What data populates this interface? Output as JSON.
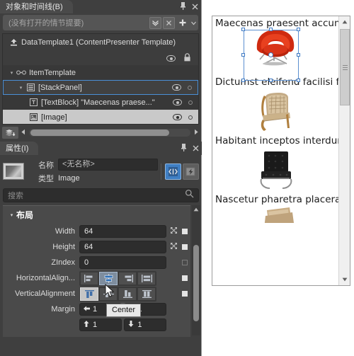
{
  "objects_panel": {
    "tab_title": "对象和时间线(B)",
    "pin_icon": "pin-icon",
    "close_icon": "close-icon",
    "storyboard": {
      "text": "(没有打开的情节提要)",
      "buttons": [
        {
          "name": "storyboard-picker-button",
          "glyph": "»"
        },
        {
          "name": "storyboard-close-button",
          "glyph": "✕"
        },
        {
          "name": "storyboard-new-button",
          "glyph": "＋"
        },
        {
          "name": "storyboard-menu-button",
          "glyph": "▾"
        }
      ]
    },
    "tree": {
      "root": {
        "label": "DataTemplate1 (ContentPresenter Template)",
        "icon": "return-scope-icon"
      },
      "root_eye_icon": "eye-icon",
      "root_lock_icon": "lock-icon",
      "nodes": [
        {
          "label": "ItemTemplate",
          "icon": "template-icon",
          "indent": 0,
          "twisty": "▾",
          "state": "normal",
          "eye": false,
          "dot": false
        },
        {
          "label": "[StackPanel]",
          "icon": "stackpanel-icon",
          "indent": 1,
          "twisty": "▾",
          "state": "focused",
          "eye": true,
          "dot": true
        },
        {
          "label": "[TextBlock] \"Maecenas praese...\"",
          "icon": "textblock-icon",
          "indent": 2,
          "twisty": "",
          "state": "normal",
          "eye": true,
          "dot": true
        },
        {
          "label": "[Image]",
          "icon": "image-icon",
          "indent": 2,
          "twisty": "",
          "state": "selected",
          "eye": true,
          "dot": true
        }
      ]
    },
    "footer": {
      "layers_button": "layers-icon",
      "scroll_left_icon": "arrow-left-icon",
      "scroll_right_icon": "arrow-right-icon"
    }
  },
  "properties_panel": {
    "tab_title": "属性(I)",
    "pin_icon": "pin-icon",
    "close_icon": "close-icon",
    "thumbnail": "image-thumbnail",
    "name_label": "名称",
    "name_value": "<无名称>",
    "type_label": "类型",
    "type_value": "Image",
    "properties_button": "properties-icon",
    "events_button": "events-icon",
    "search_placeholder": "搜索",
    "search_icon": "search-icon",
    "layout": {
      "section_title": "布局",
      "twisty": "▾",
      "rows": [
        {
          "label": "Width",
          "value": "64",
          "advanced": true,
          "marker": "solid"
        },
        {
          "label": "Height",
          "value": "64",
          "advanced": true,
          "marker": "solid"
        },
        {
          "label": "ZIndex",
          "value": "0",
          "advanced": false,
          "marker": "hollow"
        }
      ],
      "horizontal_alignment": {
        "label": "HorizontalAlign...",
        "options": [
          "Left",
          "Center",
          "Right",
          "Stretch"
        ],
        "selected_index": 1,
        "marker": "solid"
      },
      "vertical_alignment": {
        "label": "VerticalAlignment",
        "options": [
          "Top",
          "Center",
          "Bottom",
          "Stretch"
        ],
        "selected_index": 0,
        "marker": "solid"
      },
      "margin": {
        "label": "Margin",
        "left": "1",
        "right": "1",
        "top": "1",
        "bottom": "1",
        "marker": "solid"
      }
    },
    "scrollbar": {
      "up_icon": "arrow-up-icon"
    }
  },
  "tooltip": {
    "text": "Center"
  },
  "artboard": {
    "items": [
      {
        "text": "Maecenas praesent accumsa",
        "image": "red-swan-chair",
        "selected": true
      },
      {
        "text": "Dictumst eleifend facilisi fau",
        "image": "wood-lounge-chair",
        "selected": false
      },
      {
        "text": "Habitant inceptos interdum l",
        "image": "black-barcelona-chair",
        "selected": false
      },
      {
        "text": "Nascetur pharetra placerat p",
        "image": "tan-bench",
        "selected": false
      }
    ],
    "scroll_up_icon": "arrow-up-icon",
    "scroll_down_icon": "arrow-down-icon"
  },
  "colors": {
    "dock_bg": "#3f3f3f",
    "section_bg": "#4a4a4a",
    "accent_blue": "#4a8fd6",
    "selection_light": "#c9c9c9",
    "field_bg": "#2d2d2d"
  }
}
